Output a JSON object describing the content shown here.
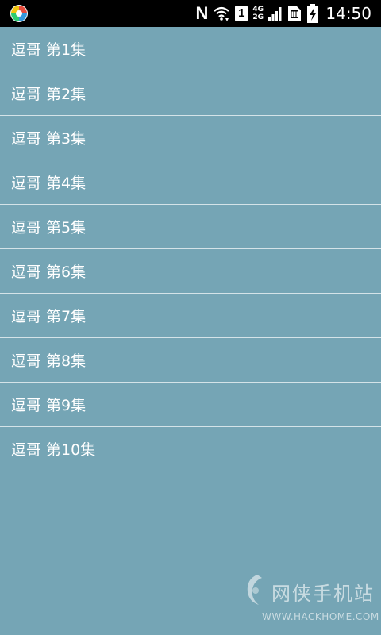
{
  "status_bar": {
    "time": "14:50",
    "network_type_top": "4G",
    "network_type_bottom": "2G",
    "sim_slot": "1",
    "nfc_letter": "N",
    "icons": [
      "app-icon",
      "nfc-icon",
      "wifi-icon",
      "sim-icon",
      "signal-icon",
      "sim-card-icon",
      "battery-charging-icon"
    ]
  },
  "episodes": [
    {
      "label": "逗哥 第1集"
    },
    {
      "label": "逗哥 第2集"
    },
    {
      "label": "逗哥 第3集"
    },
    {
      "label": "逗哥 第4集"
    },
    {
      "label": "逗哥 第5集"
    },
    {
      "label": "逗哥 第6集"
    },
    {
      "label": "逗哥 第7集"
    },
    {
      "label": "逗哥 第8集"
    },
    {
      "label": "逗哥 第9集"
    },
    {
      "label": "逗哥 第10集"
    }
  ],
  "watermark": {
    "brand": "网侠手机站",
    "url": "WWW.HACKHOME.COM"
  },
  "colors": {
    "background": "#75a5b5",
    "divider": "#d4e3e8",
    "status_bar": "#000000",
    "text": "#ffffff"
  }
}
